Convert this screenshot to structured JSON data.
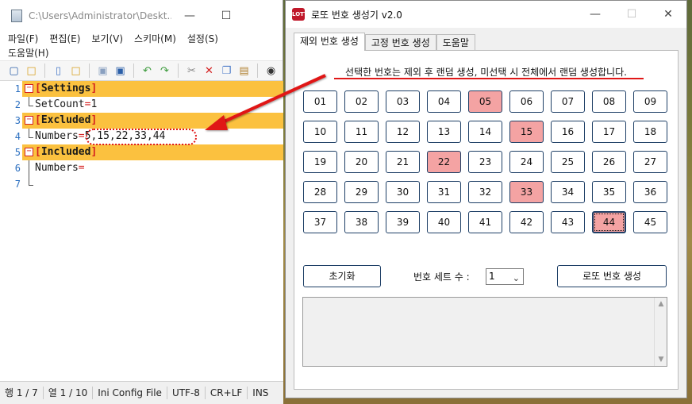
{
  "editor": {
    "title": "C:\\Users\\Administrator\\Deskt...",
    "menu": [
      "파일(F)",
      "편집(E)",
      "보기(V)",
      "스키마(M)",
      "설정(S)",
      "도움말(H)"
    ],
    "lines": [
      {
        "num": "1",
        "type": "section",
        "text": "Settings"
      },
      {
        "num": "2",
        "type": "kv",
        "key": "SetCount",
        "eq": "=",
        "value": "1"
      },
      {
        "num": "3",
        "type": "section",
        "text": "Excluded"
      },
      {
        "num": "4",
        "type": "kv",
        "key": "Numbers",
        "eq": "=",
        "value": "5,15,22,33,44"
      },
      {
        "num": "5",
        "type": "section",
        "text": "Included"
      },
      {
        "num": "6",
        "type": "kv",
        "key": "Numbers",
        "eq": "=",
        "value": ""
      },
      {
        "num": "7",
        "type": "empty"
      }
    ],
    "status": [
      "행 1 / 7",
      "열 1 / 10",
      "Ini Config File",
      "UTF-8",
      "CR+LF",
      "INS"
    ]
  },
  "lotto": {
    "title": "로또 번호 생성기 v2.0",
    "tabs": [
      "제외 번호 생성",
      "고정 번호 생성",
      "도움말"
    ],
    "active_tab": 0,
    "notice": "선택한 번호는 제외 후 랜덤 생성, 미선택 시 전체에서 랜덤 생성합니다.",
    "numbers": [
      "01",
      "02",
      "03",
      "04",
      "05",
      "06",
      "07",
      "08",
      "09",
      "10",
      "11",
      "12",
      "13",
      "14",
      "15",
      "16",
      "17",
      "18",
      "19",
      "20",
      "21",
      "22",
      "23",
      "24",
      "25",
      "26",
      "27",
      "28",
      "29",
      "30",
      "31",
      "32",
      "33",
      "34",
      "35",
      "36",
      "37",
      "38",
      "39",
      "40",
      "41",
      "42",
      "43",
      "44",
      "45"
    ],
    "selected": [
      "05",
      "15",
      "22",
      "33",
      "44"
    ],
    "focused": "44",
    "reset_label": "초기화",
    "set_count_label": "번호 세트 수 :",
    "set_count_value": "1",
    "generate_label": "로또 번호 생성",
    "colors": {
      "selected": "#f4a3a3",
      "button_border": "#1e3f66",
      "section_bg": "#fbc13f",
      "annotation": "#e01818"
    }
  }
}
